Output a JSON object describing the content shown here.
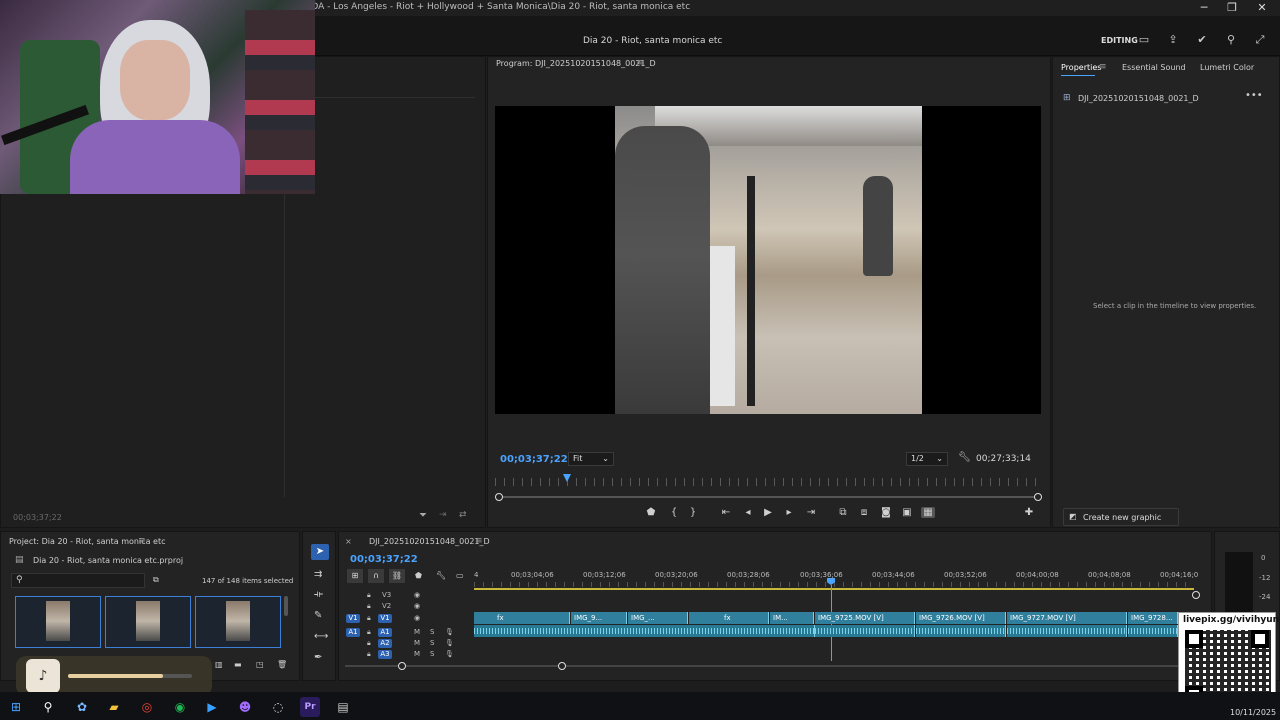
{
  "window": {
    "title": "Adobe Premiere Pro 2025 - V:\\+ TIKTOK\\Twitch Con\\Dia 20 SEGUNDA - Los Angeles - Riot + Hollywood + Santa Monica\\Dia 20 - Riot, santa monica etc",
    "app_icon": "Pr",
    "min": "─",
    "max": "❐",
    "close": "✕"
  },
  "appbar": {
    "document_title": "Dia 20 - Riot, santa monica etc",
    "workspace": "EDITING"
  },
  "program": {
    "title": "Program: DJI_20251020151048_0021_D",
    "timecode": "00;03;37;22",
    "fit": "Fit",
    "resolution": "1/2",
    "duration": "00;27;33;14"
  },
  "source": {
    "timecode": "00;03;37;22"
  },
  "properties": {
    "tabs": [
      "Properties",
      "Essential Sound",
      "Lumetri Color"
    ],
    "clip_name": "DJI_20251020151048_0021_D",
    "empty_message": "Select a clip in the timeline to view properties.",
    "create_graphic": "Create new graphic"
  },
  "project": {
    "title": "Project: Dia 20 - Riot, santa monica etc",
    "file": "Dia 20 - Riot, santa monica etc.prproj",
    "selection": "147 of 148 items selected"
  },
  "timeline": {
    "sequence": "DJI_20251020151048_0021_D",
    "timecode": "00;03;37;22",
    "ruler": [
      "00;03;04;06",
      "00;03;12;06",
      "00;03;20;06",
      "00;03;28;06",
      "00;03;36;06",
      "00;03;44;06",
      "00;03;52;06",
      "00;04;00;08",
      "00;04;08;08",
      "00;04;16;0"
    ],
    "ruler_first": "4",
    "video_tracks": [
      "V3",
      "V2",
      "V1"
    ],
    "audio_tracks": [
      "A1",
      "A2",
      "A3"
    ],
    "clips": [
      "IMG_9...",
      "IMG_...",
      "IM...",
      "IMG_9725.MOV [V]",
      "IMG_9726.MOV [V]",
      "IMG_9727.MOV [V]",
      "IMG_9728..."
    ],
    "fx": "fx"
  },
  "meters": {
    "labels": [
      "0",
      "-12",
      "-24"
    ]
  },
  "overlay": {
    "qr_caption": "livepix.gg/vivihyun",
    "music_progress": 0.77
  },
  "taskbar": {
    "date": "10/11/2025"
  }
}
